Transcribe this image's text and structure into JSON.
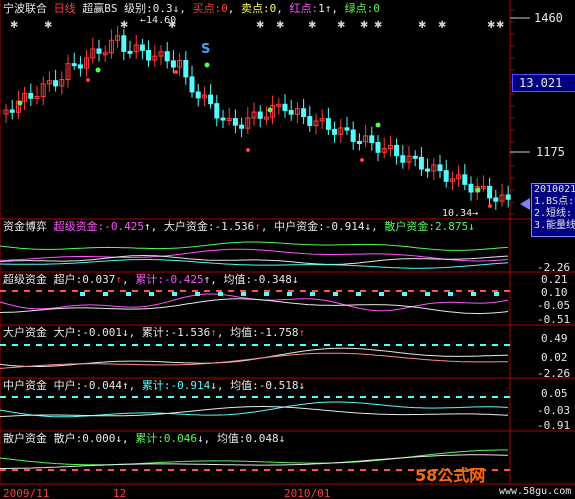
{
  "header": {
    "stock_name": "宁波联合",
    "period": "日线",
    "indicator": "超赢BS",
    "level_label": "级别:",
    "level_value": "0.3",
    "buy_label": "买点:",
    "buy_value": "0",
    "sell_label": "卖点:",
    "sell_value": "0",
    "red_label": "红点:",
    "red_value": "1",
    "green_label": "绿点:",
    "green_value": "0"
  },
  "price_panel": {
    "axis_top": "1460",
    "current_price": "13.021",
    "axis_mid": "1175",
    "high_marker": "14.60",
    "low_marker": "10.34",
    "s_marker": "S",
    "popup_date": "2010021",
    "popup_items": [
      "1.BS点:",
      "2.短线:",
      "3.能量线"
    ]
  },
  "panel_game": {
    "title": "资金博弈",
    "items": [
      {
        "label": "超级资金:",
        "value": "-0.425",
        "arrow": "↑"
      },
      {
        "label": "大户资金:",
        "value": "-1.536",
        "arrow": "↑"
      },
      {
        "label": "中户资金:",
        "value": "-0.914",
        "arrow": "↓"
      },
      {
        "label": "散户资金:",
        "value": "2.875",
        "arrow": "↓"
      }
    ],
    "axis": [
      "-2.26"
    ]
  },
  "panel_super": {
    "title": "超级资金",
    "a_label": "超户:",
    "a_value": "0.037",
    "a_arrow": "↑",
    "b_label": "累计:",
    "b_value": "-0.425",
    "b_arrow": "↑",
    "c_label": "均值:",
    "c_value": "-0.348",
    "c_arrow": "↓",
    "axis": [
      "0.21",
      "0.10",
      "-0.05",
      "-0.51"
    ]
  },
  "panel_big": {
    "title": "大户资金",
    "a_label": "大户:",
    "a_value": "-0.001",
    "a_arrow": "↓",
    "b_label": "累计:",
    "b_value": "-1.536",
    "b_arrow": "↑",
    "c_label": "均值:",
    "c_value": "-1.758",
    "c_arrow": "↑",
    "axis": [
      "0.49",
      "0.02",
      "-2.26"
    ]
  },
  "panel_mid": {
    "title": "中户资金",
    "a_label": "中户:",
    "a_value": "-0.044",
    "a_arrow": "↑",
    "b_label": "累计:",
    "b_value": "-0.914",
    "b_arrow": "↓",
    "c_label": "均值:",
    "c_value": "-0.518",
    "c_arrow": "↓",
    "axis": [
      "0.05",
      "-0.03",
      "-0.91"
    ]
  },
  "panel_retail": {
    "title": "散户资金",
    "a_label": "散户:",
    "a_value": "0.000",
    "a_arrow": "↓",
    "b_label": "累计:",
    "b_value": "0.046",
    "b_arrow": "↓",
    "c_label": "均值:",
    "c_value": "0.048",
    "c_arrow": "↓"
  },
  "date_axis": [
    "2009/11",
    "12",
    "2010/01"
  ],
  "watermark": {
    "brand": "58公式网",
    "url": "www.58gu.com"
  },
  "colors": {
    "up": "#ff3c3c",
    "down": "#54fcfc",
    "frame": "#b00000",
    "yellow": "#ffff54",
    "magenta": "#ff54ff",
    "green": "#54fc54"
  }
}
